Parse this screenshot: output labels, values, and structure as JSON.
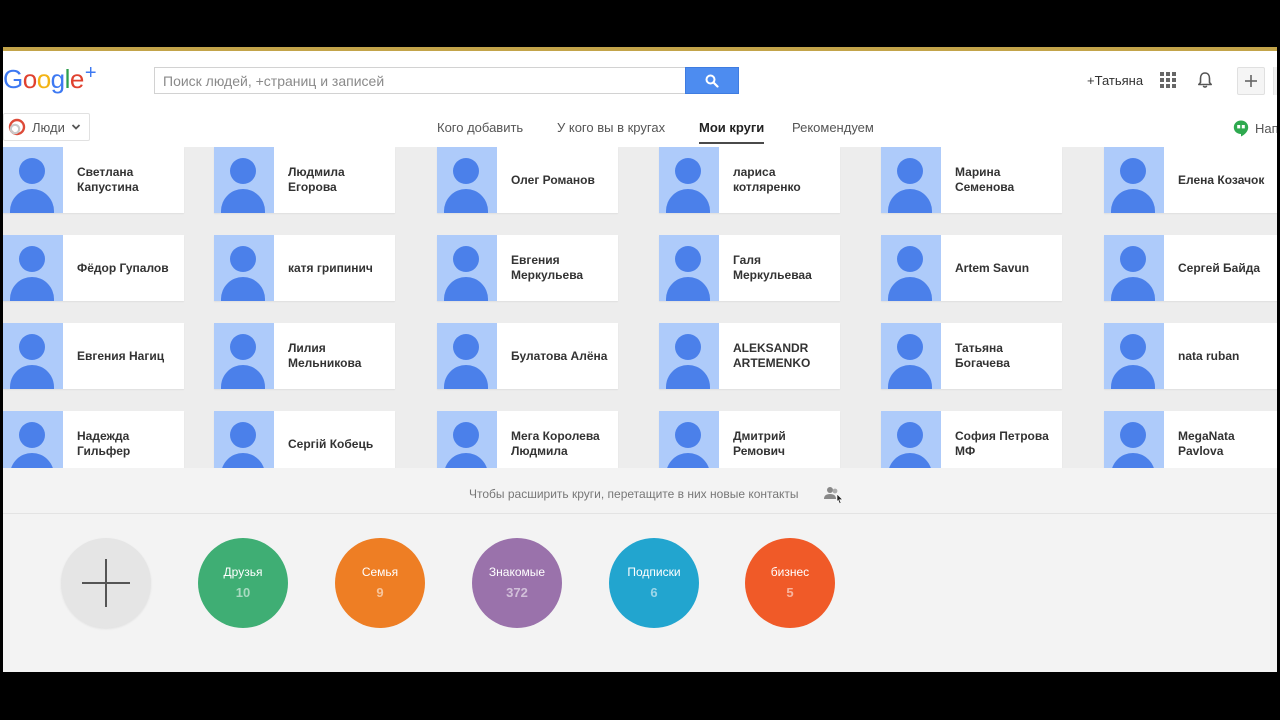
{
  "header": {
    "logo_text": "Google+",
    "search_placeholder": "Поиск людей, +страниц и записей",
    "user_name": "+Татьяна"
  },
  "subnav": {
    "people_label": "Люди",
    "tabs": [
      {
        "label": "Кого добавить",
        "active": false
      },
      {
        "label": "У кого вы в кругах",
        "active": false
      },
      {
        "label": "Мои круги",
        "active": true
      },
      {
        "label": "Рекомендуем",
        "active": false
      }
    ],
    "hangouts_label": "Нап"
  },
  "contacts": [
    [
      "Светлана Капустина",
      "Людмила Егорова",
      "Олег Романов",
      "лариса котляренко",
      "Марина Семенова",
      "Елена Козачок"
    ],
    [
      "Фёдор Гупалов",
      "катя грипинич",
      "Евгения Меркульева",
      "Галя Меркульеваа",
      "Artem Savun",
      "Сергей Байда"
    ],
    [
      "Евгения Нагиц",
      "Лилия Мельникова",
      "Булатова Алёна",
      "ALEKSANDR ARTEMENKO",
      "Татьяна Богачева",
      "nata ruban"
    ],
    [
      "Надежда Гильфер",
      "Сергій Кобець",
      "Мега Королева Людмила",
      "Дмитрий Ремович",
      "София Петрова МФ",
      "MegaNata Pavlova"
    ]
  ],
  "hint": "Чтобы расширить круги, перетащите в них новые контакты",
  "circles": [
    {
      "name": "Друзья",
      "count": "10",
      "color": "#3fae74"
    },
    {
      "name": "Семья",
      "count": "9",
      "color": "#ee7e24"
    },
    {
      "name": "Знакомые",
      "count": "372",
      "color": "#9a72ab"
    },
    {
      "name": "Подписки",
      "count": "6",
      "color": "#22a5cf"
    },
    {
      "name": "бизнес",
      "count": "5",
      "color": "#f05a28"
    }
  ],
  "colors": {
    "accent_blue": "#4d8cf0",
    "top_border": "#c3a44a",
    "avatar_bg": "#aecbfa",
    "avatar_fg": "#4b80ea"
  }
}
